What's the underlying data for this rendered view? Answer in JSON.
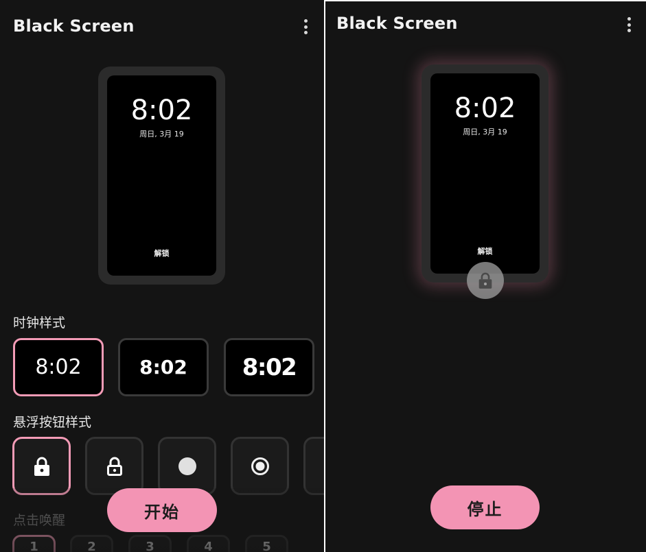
{
  "left": {
    "app_title": "Black Screen",
    "preview": {
      "time": "8:02",
      "date": "周日, 3月 19",
      "unlock_label": "解锁"
    },
    "clock_style_label": "时钟样式",
    "clock_styles": [
      "8:02",
      "8:02",
      "8:02"
    ],
    "float_button_label": "悬浮按钮样式",
    "float_buttons": [
      "lock-filled-icon",
      "lock-outline-icon",
      "dot-icon",
      "radio-icon",
      "cutoff-option"
    ],
    "wake_label": "点击唤醒",
    "wake_options": [
      "1",
      "2",
      "3",
      "4",
      "5"
    ],
    "start_label": "开始"
  },
  "right": {
    "app_title": "Black Screen",
    "preview": {
      "time": "8:02",
      "date": "周日, 3月 19",
      "unlock_label": "解锁"
    },
    "stop_label": "停止"
  },
  "colors": {
    "accent": "#f394b4",
    "background": "#141414",
    "card": "#2b2b2b"
  }
}
